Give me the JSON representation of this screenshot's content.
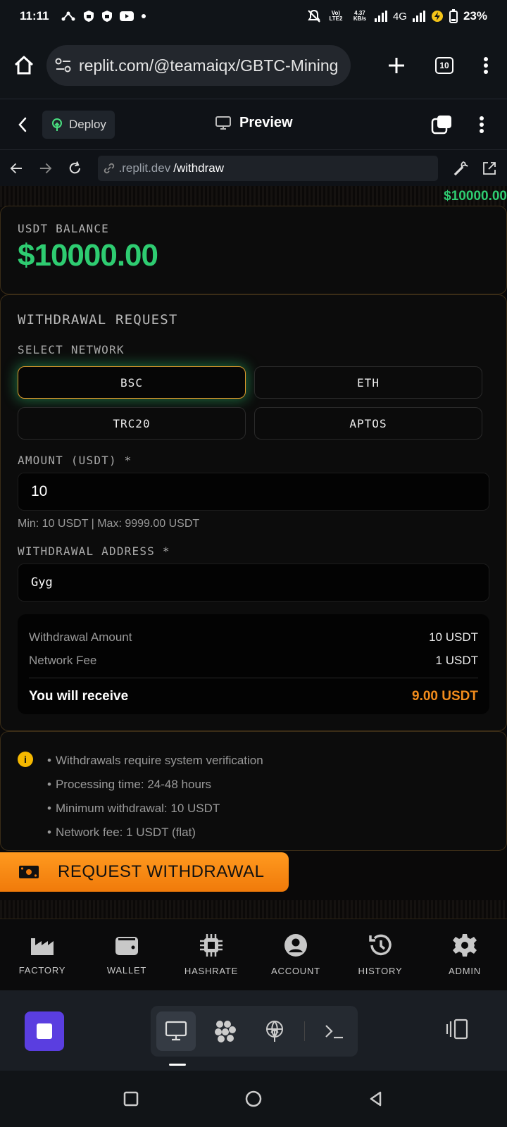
{
  "status_bar": {
    "time": "11:11",
    "volte": "Vo) LTE2",
    "speed": "4.37 KB/s",
    "network": "4G",
    "battery": "23%"
  },
  "browser": {
    "url": "replit.com/@teamaiqx/GBTC-Mining",
    "tab_count": "10"
  },
  "replit_header": {
    "deploy_label": "Deploy",
    "preview_label": "Preview"
  },
  "inner_nav": {
    "url_prefix": ".replit.dev",
    "url_path": "/withdraw"
  },
  "app": {
    "top_balance": "$10000.00",
    "balance_label": "USDT BALANCE",
    "balance_value": "$10000.00",
    "withdraw_title": "WITHDRAWAL REQUEST",
    "network_label": "SELECT NETWORK",
    "networks": [
      "BSC",
      "ETH",
      "TRC20",
      "APTOS"
    ],
    "selected_network": "BSC",
    "amount_label": "AMOUNT (USDT) *",
    "amount_value": "10",
    "amount_hint": "Min: 10 USDT | Max: 9999.00 USDT",
    "address_label": "WITHDRAWAL ADDRESS *",
    "address_value": "Gyg",
    "summary": {
      "amount_label": "Withdrawal Amount",
      "amount_value": "10 USDT",
      "fee_label": "Network Fee",
      "fee_value": "1 USDT",
      "receive_label": "You will receive",
      "receive_value": "9.00 USDT"
    },
    "info_items": [
      "Withdrawals require system verification",
      "Processing time: 24-48 hours",
      "Minimum withdrawal: 10 USDT",
      "Network fee: 1 USDT (flat)"
    ],
    "withdraw_button": "REQUEST WITHDRAWAL"
  },
  "app_nav": {
    "items": [
      "FACTORY",
      "WALLET",
      "HASHRATE",
      "ACCOUNT",
      "HISTORY",
      "ADMIN"
    ]
  },
  "colors": {
    "accent_green": "#2ecc71",
    "accent_orange": "#f28c1c",
    "replit_purple": "#5a3ee0"
  }
}
